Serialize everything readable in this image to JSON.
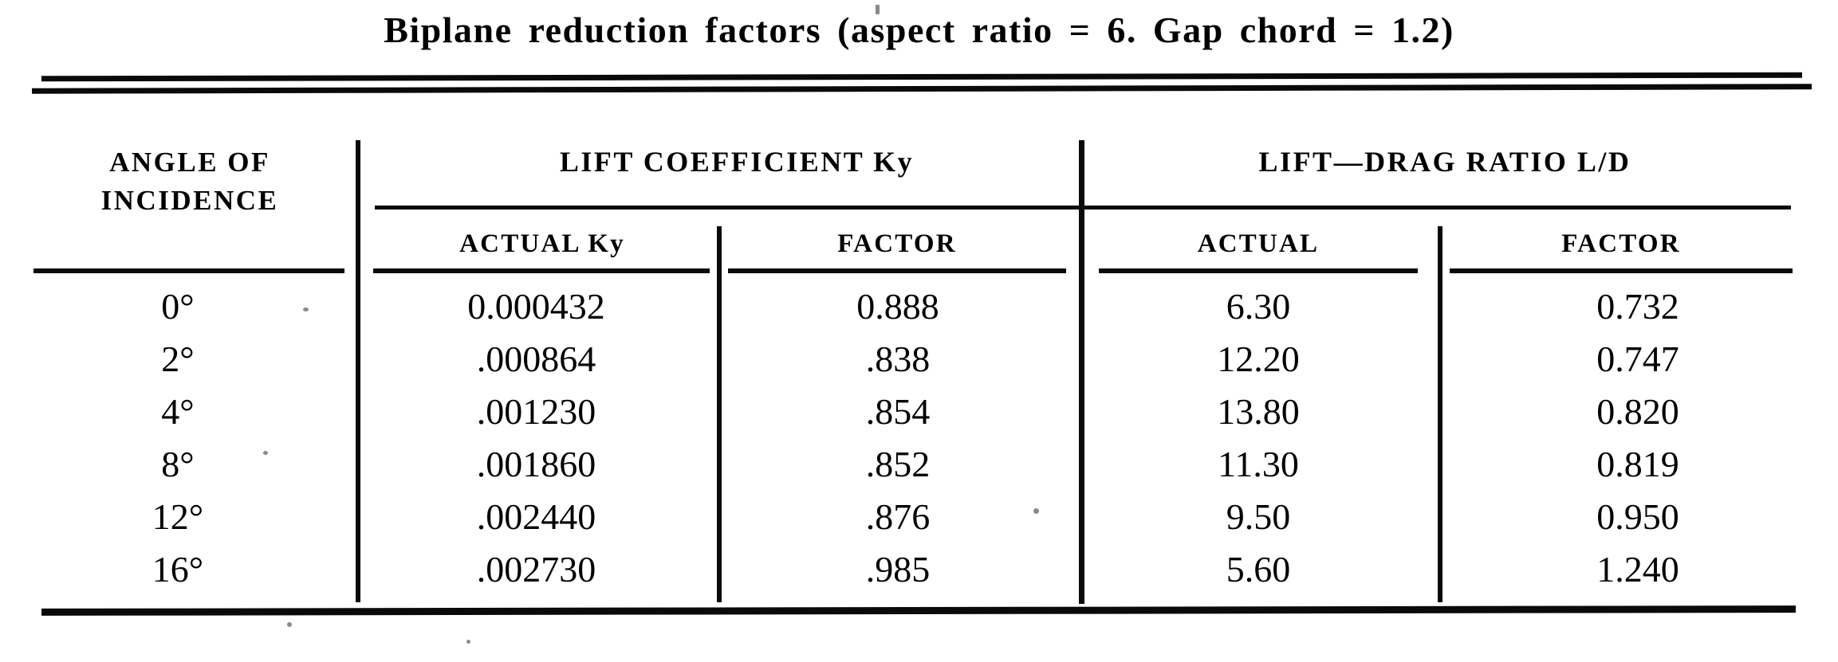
{
  "title": "Biplane reduction factors (aspect ratio = 6.  Gap chord = 1.2)",
  "header": {
    "angle_line1": "ANGLE OF",
    "angle_line2": "INCIDENCE",
    "group_ky": "LIFT COEFFICIENT Ky",
    "group_ld": "LIFT—DRAG RATIO L/D",
    "sub_actual_ky": "ACTUAL Ky",
    "sub_factor_ky": "FACTOR",
    "sub_actual_ld": "ACTUAL",
    "sub_factor_ld": "FACTOR"
  },
  "chart_data": {
    "type": "table",
    "title": "Biplane reduction factors (aspect ratio = 6.  Gap chord = 1.2)",
    "columns": [
      "ANGLE OF INCIDENCE",
      "LIFT COEFFICIENT Ky - ACTUAL Ky",
      "LIFT COEFFICIENT Ky - FACTOR",
      "LIFT—DRAG RATIO L/D - ACTUAL",
      "LIFT—DRAG RATIO L/D - FACTOR"
    ],
    "column_groups": [
      {
        "label": "ANGLE OF INCIDENCE",
        "span": 1
      },
      {
        "label": "LIFT COEFFICIENT Ky",
        "span": 2
      },
      {
        "label": "LIFT—DRAG RATIO L/D",
        "span": 2
      }
    ],
    "angles_deg": [
      0,
      2,
      4,
      8,
      12,
      16
    ],
    "series": [
      {
        "name": "ACTUAL Ky",
        "values": [
          0.000432,
          0.000864,
          0.00123,
          0.00186,
          0.00244,
          0.00273
        ]
      },
      {
        "name": "Ky FACTOR",
        "values": [
          0.888,
          0.838,
          0.854,
          0.852,
          0.876,
          0.985
        ]
      },
      {
        "name": "ACTUAL L/D",
        "values": [
          6.3,
          12.2,
          13.8,
          11.3,
          9.5,
          5.6
        ]
      },
      {
        "name": "L/D FACTOR",
        "values": [
          0.732,
          0.747,
          0.82,
          0.819,
          0.95,
          1.24
        ]
      }
    ],
    "rows": [
      {
        "angle": "0°",
        "actual_ky": "0.000432",
        "factor_ky": "0.888",
        "actual_ld": "6.30",
        "factor_ld": "0.732"
      },
      {
        "angle": "2°",
        "actual_ky": ".000864",
        "factor_ky": ".838",
        "actual_ld": "12.20",
        "factor_ld": "0.747"
      },
      {
        "angle": "4°",
        "actual_ky": ".001230",
        "factor_ky": ".854",
        "actual_ld": "13.80",
        "factor_ld": "0.820"
      },
      {
        "angle": "8°",
        "actual_ky": ".001860",
        "factor_ky": ".852",
        "actual_ld": "11.30",
        "factor_ld": "0.819"
      },
      {
        "angle": "12°",
        "actual_ky": ".002440",
        "factor_ky": ".876",
        "actual_ld": "9.50",
        "factor_ld": "0.950"
      },
      {
        "angle": "16°",
        "actual_ky": ".002730",
        "factor_ky": ".985",
        "actual_ld": "5.60",
        "factor_ld": "1.240"
      }
    ]
  }
}
